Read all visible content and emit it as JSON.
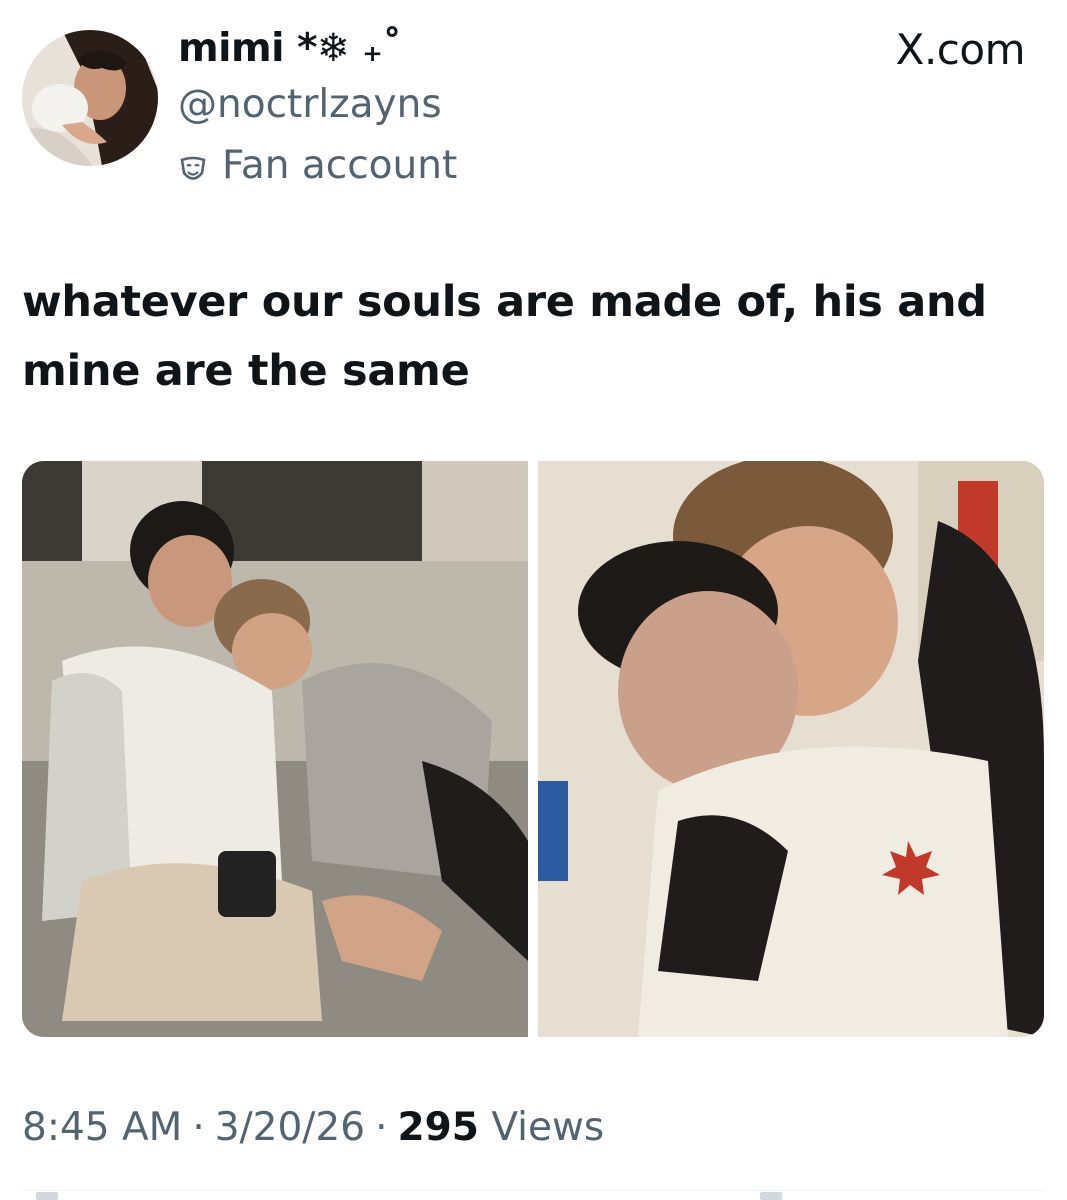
{
  "source": "X.com",
  "author": {
    "display_name": "mimi *❄ ₊˚",
    "handle": "@noctrlzayns",
    "label": "Fan account",
    "label_icon": "theater-mask-icon"
  },
  "tweet": {
    "text": "whatever our souls are made of, his and mine are the same",
    "images": [
      {
        "id": "photo-left",
        "icon": "photo"
      },
      {
        "id": "photo-right",
        "icon": "photo"
      }
    ]
  },
  "meta": {
    "time": "8:45 AM",
    "date": "3/20/26",
    "views_count": "295",
    "views_label": "Views",
    "separator": "·"
  },
  "colors": {
    "text_primary": "#0f1419",
    "text_secondary": "#536471",
    "background": "#ffffff"
  }
}
